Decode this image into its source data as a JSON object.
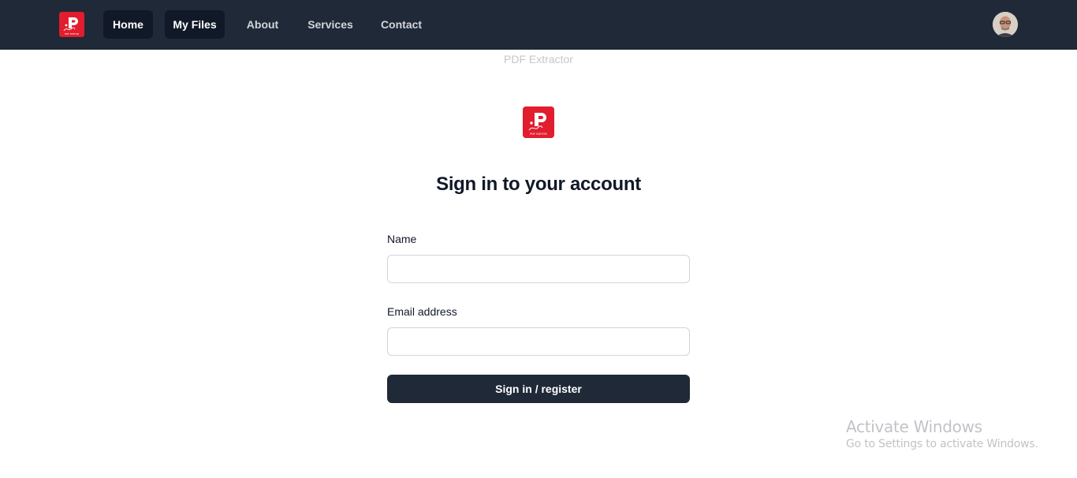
{
  "nav": {
    "logo_icon": "pdf-editor-logo-icon",
    "items": [
      {
        "label": "Home",
        "active": true
      },
      {
        "label": "My Files",
        "active": true
      },
      {
        "label": "About",
        "active": false
      },
      {
        "label": "Services",
        "active": false
      },
      {
        "label": "Contact",
        "active": false
      }
    ],
    "avatar_icon": "user-avatar"
  },
  "app": {
    "name": "PDF Extractor",
    "logo_icon": "pdf-editor-logo-icon",
    "logo_text": "PDF EDITOR"
  },
  "form": {
    "heading": "Sign in to your account",
    "name_label": "Name",
    "name_value": "",
    "email_label": "Email address",
    "email_value": "",
    "submit_label": "Sign in / register"
  },
  "watermark": {
    "title": "Activate Windows",
    "subtitle": "Go to Settings to activate Windows."
  },
  "colors": {
    "navbar_bg": "#1f2937",
    "nav_active_bg": "#111827",
    "brand_red": "#e11d2e",
    "button_bg": "#1f2937"
  }
}
